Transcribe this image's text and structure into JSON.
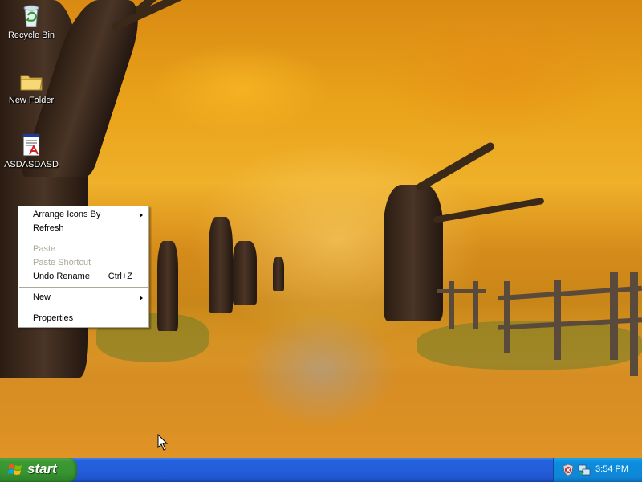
{
  "desktop": {
    "icons": [
      {
        "label": "Recycle Bin",
        "icon": "recycle-bin-icon"
      },
      {
        "label": "New Folder",
        "icon": "folder-icon"
      },
      {
        "label": "ASDASDASD",
        "icon": "document-icon"
      }
    ]
  },
  "context_menu": {
    "items": [
      {
        "label": "Arrange Icons By",
        "submenu": true,
        "enabled": true
      },
      {
        "label": "Refresh",
        "enabled": true
      },
      {
        "label": "Paste",
        "enabled": false
      },
      {
        "label": "Paste Shortcut",
        "enabled": false
      },
      {
        "label": "Undo Rename",
        "shortcut": "Ctrl+Z",
        "enabled": true
      },
      {
        "label": "New",
        "submenu": true,
        "enabled": true
      },
      {
        "label": "Properties",
        "enabled": true
      }
    ]
  },
  "taskbar": {
    "start_label": "start",
    "tray": {
      "clock": "3:54 PM",
      "icons": [
        "security-alert-icon",
        "network-icon"
      ]
    }
  },
  "colors": {
    "taskbar_blue": "#245edb",
    "start_green": "#379531",
    "tray_blue": "#0f86d6"
  }
}
